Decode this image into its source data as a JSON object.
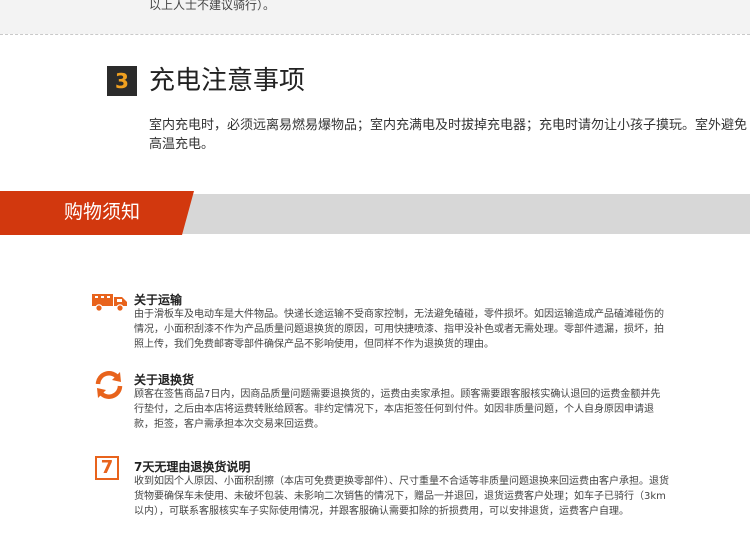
{
  "top_note": "以上人士不建议骑行）。",
  "charging": {
    "number": "3",
    "title": "充电注意事项",
    "text": "室内充电时，必须远离易燃易爆物品；室内充满电及时拔掉充电器；充电时请勿让小孩子摸玩。室外避免高温充电。"
  },
  "banner": {
    "title": "购物须知"
  },
  "shipping": {
    "icon": "truck-icon",
    "title": "关于运输",
    "body": "由于滑板车及电动车是大件物品。快递长途运输不受商家控制，无法避免磕碰，零件损坏。如因运输造成产品磕滩碰伤的情况，小面积刮漆不作为产品质量问题退换货的原因，可用快捷喷漆、指甲没补色或者无需处理。零部件遗漏，损坏，拍照上传，我们免费邮寄零部件确保产品不影响使用，但同样不作为退换货的理由。"
  },
  "returns": {
    "icon": "refresh-icon",
    "title": "关于退换货",
    "body": "顾客在签售商品7日内，因商品质量问题需要退换货的，运费由卖家承担。顾客需要跟客服核实确认退回的运费金额并先行垫付，之后由本店将运费转账给顾客。非约定情况下，本店拒签任何到付件。如因非质量问题，个人自身原因申请退款，拒签，客户需承担本次交易来回运费。"
  },
  "seven_day": {
    "icon": "seven-icon",
    "icon_glyph": "7",
    "title": "7天无理由退换货说明",
    "body": "收到如因个人原因、小面积刮擦（本店可免费更换零部件）、尺寸重量不合适等非质量问题退换来回运费由客户承担。退货货物要确保车未使用、未破坏包装、未影响二次销售的情况下，赠品一并退回，退货运费客户处理；如车子已骑行（3km以内），可联系客服核实车子实际使用情况，并跟客服确认需要扣除的折损费用，可以安排退货，运费客户自理。"
  },
  "colors": {
    "accent_red": "#d2380e",
    "icon_orange": "#e8631c",
    "banner_gray": "#d7d7d7"
  }
}
